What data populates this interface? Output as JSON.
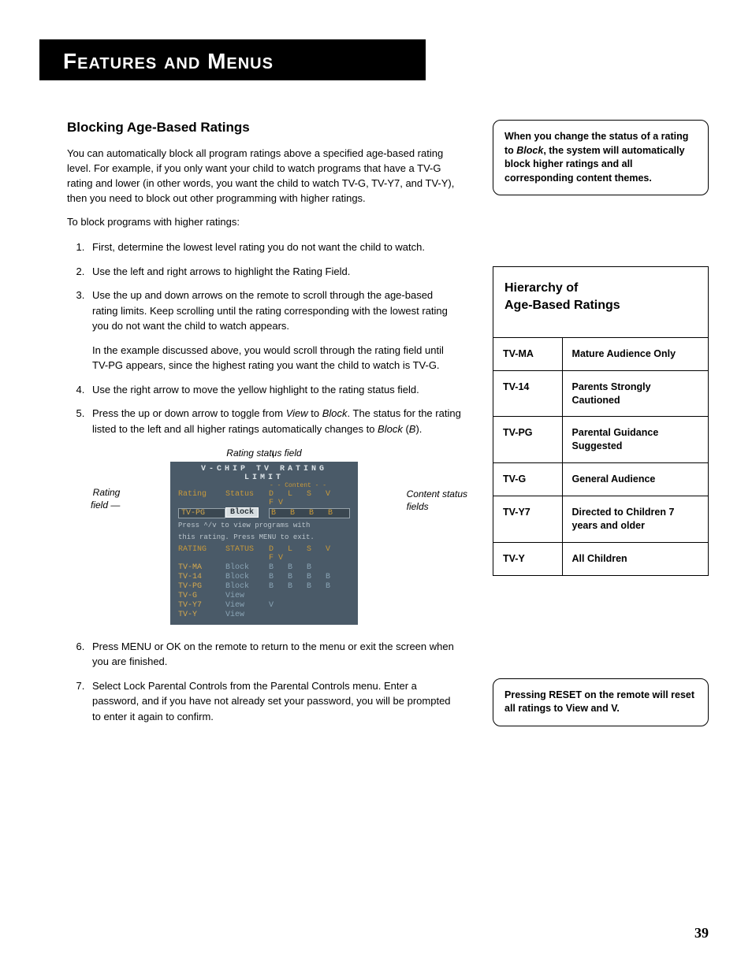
{
  "page": {
    "bannerTitle": "Features and Menus",
    "pageNumber": "39"
  },
  "section": {
    "heading": "Blocking Age-Based Ratings",
    "intro": "You can automatically block all program ratings above a specified age-based rating level. For example, if you only want your child to watch programs that have a TV-G rating and lower (in other words, you want the child to watch TV-G, TV-Y7, and TV-Y), then you need to block out other programming with higher ratings.",
    "lead": "To block programs with higher ratings:",
    "steps": [
      "First, determine the lowest level rating you do not want the child to watch.",
      "Use the left and right arrows to highlight the Rating Field.",
      "Use the up and down arrows on the remote to scroll through the age-based rating limits. Keep scrolling until the rating corresponding with the lowest rating you do not want the child to watch appears.",
      "Use the right arrow to move the yellow highlight to the rating status field.",
      "Press the up or down arrow to toggle from View to Block. The status for the rating listed to the left and all higher ratings automatically changes to Block (B).",
      "Press MENU or OK on the remote to return to the menu or exit the screen when you are finished.",
      "Select Lock Parental Controls from the Parental Controls menu. Enter a password, and if you have not already set your password, you will be prompted to enter it again to confirm."
    ],
    "step3extra": "In the example discussed above, you would scroll through the rating field until TV-PG appears, since the highest rating you want the child to watch is TV-G."
  },
  "figure": {
    "topLabel": "Rating status field",
    "leftLabel": "Rating field",
    "rightLabel": "Content status fields",
    "screen": {
      "title": "V-CHIP TV RATING LIMIT",
      "contentLabel": "- - Content - -",
      "headerRow": {
        "rating": "Rating",
        "status": "Status",
        "cols": "D L S V FV"
      },
      "selectedRow": {
        "rating": "TV-PG",
        "status": "Block",
        "cols": "B B B B"
      },
      "help1": "Press ^/v to view programs with",
      "help2": "this rating. Press MENU to exit.",
      "tableHeader": {
        "rating": "RATING",
        "status": "STATUS",
        "cols": "D L S V FV"
      },
      "rows": [
        {
          "rating": "TV-MA",
          "status": "Block",
          "cols": "  B B B"
        },
        {
          "rating": "TV-14",
          "status": "Block",
          "cols": "B B B B"
        },
        {
          "rating": "TV-PG",
          "status": "Block",
          "cols": "B B B B"
        },
        {
          "rating": "TV-G",
          "status": "View",
          "cols": ""
        },
        {
          "rating": "TV-Y7",
          "status": "View",
          "cols": "        V"
        },
        {
          "rating": "TV-Y",
          "status": "View",
          "cols": ""
        }
      ]
    }
  },
  "sidebar": {
    "callout1_pre": "When you change the status of a rating to ",
    "callout1_em": "Block",
    "callout1_post": ", the system will automatically block higher ratings and all corresponding content themes.",
    "hierarchyTitle": "Hierarchy of Age-Based Ratings",
    "hierarchy": [
      {
        "code": "TV-MA",
        "desc": "Mature Audience Only"
      },
      {
        "code": "TV-14",
        "desc": "Parents Strongly Cautioned"
      },
      {
        "code": "TV-PG",
        "desc": "Parental Guidance Suggested"
      },
      {
        "code": "TV-G",
        "desc": "General Audience"
      },
      {
        "code": "TV-Y7",
        "desc": "Directed to Children 7 years and older"
      },
      {
        "code": "TV-Y",
        "desc": "All Children"
      }
    ],
    "callout2": "Pressing RESET on the remote will reset all ratings to View and V."
  }
}
